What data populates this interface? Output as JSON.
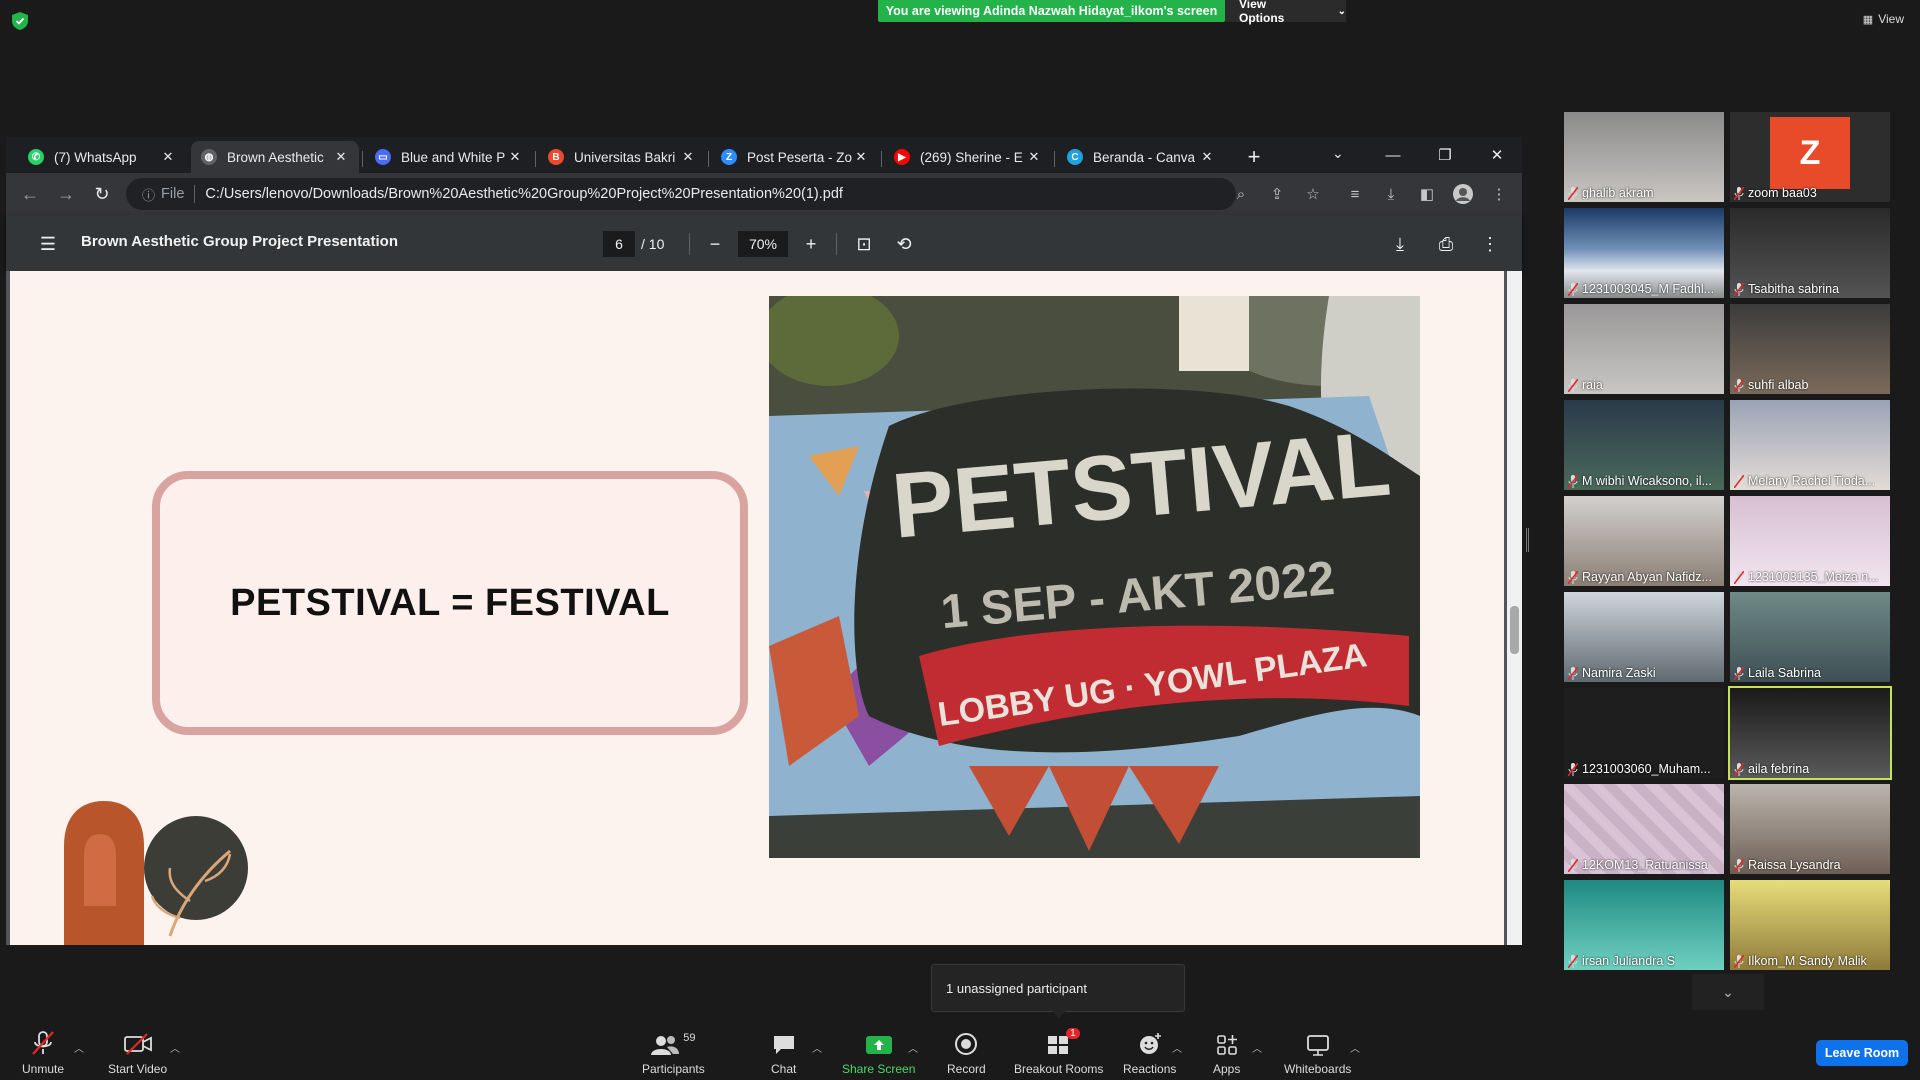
{
  "zoom": {
    "viewing_banner": "You are viewing Adinda Nazwah Hidayat_ilkom's screen",
    "view_options": "View Options",
    "view_label": "View",
    "unassigned_tooltip": "1 unassigned participant",
    "participants_count": "59",
    "breakout_badge": "1",
    "toolbar": {
      "unmute": "Unmute",
      "start_video": "Start Video",
      "participants": "Participants",
      "chat": "Chat",
      "share_screen": "Share Screen",
      "record": "Record",
      "breakout_rooms": "Breakout Rooms",
      "reactions": "Reactions",
      "apps": "Apps",
      "whiteboards": "Whiteboards",
      "leave": "Leave Room"
    },
    "participants": [
      "ghalib akram",
      "zoom baa03",
      "1231003045_M Fadhl...",
      "Tsabitha sabrina",
      "raia",
      "suhfi albab",
      "M wibhi Wicaksono, il...",
      "Melany Rachel Tioda...",
      "Rayyan Abyan Nafidz...",
      "1231003135_Meiza n...",
      "Namira Zaski",
      "Laila Sabrina",
      "1231003060_Muham...",
      "aila febrina",
      "12KOM13_Ratuanissa",
      "Raissa Lysandra",
      "irsan Juliandra S",
      "Ilkom_M Sandy Malik"
    ],
    "avatar_letter": "Z"
  },
  "chrome": {
    "tabs": [
      {
        "title": "(7) WhatsApp",
        "color": "#25d366",
        "glyph": "✆"
      },
      {
        "title": "Brown Aesthetic",
        "color": "#5f6368",
        "glyph": "◍"
      },
      {
        "title": "Blue and White P",
        "color": "#4a6cf7",
        "glyph": "▭"
      },
      {
        "title": "Universitas Bakri",
        "color": "#e94b2c",
        "glyph": "B"
      },
      {
        "title": "Post Peserta - Zo",
        "color": "#2d8cff",
        "glyph": "Z"
      },
      {
        "title": "(269) Sherine - E",
        "color": "#ff0000",
        "glyph": "▶"
      },
      {
        "title": "Beranda - Canva",
        "color": "#1fa3e0",
        "glyph": "C"
      }
    ],
    "url_prefix": "File",
    "url": "C:/Users/lenovo/Downloads/Brown%20Aesthetic%20Group%20Project%20Presentation%20(1).pdf"
  },
  "pdf": {
    "title": "Brown Aesthetic Group Project Presentation",
    "page": "6",
    "total": "/ 10",
    "zoom": "70%",
    "slide_text": "PETSTIVAL = FESTIVAL",
    "banner_line1": "PETSTIVAL",
    "banner_line2": "1 SEP - AKT 2022",
    "banner_line3": "LOBBY UG · YOWL PLAZA"
  },
  "colors": {
    "banner_green": "#23b34a",
    "leave_blue": "#0e72ed",
    "slide_bg": "#fdf3ee",
    "frame_pink": "#d9a4a0",
    "active_speaker": "#c6e357"
  }
}
